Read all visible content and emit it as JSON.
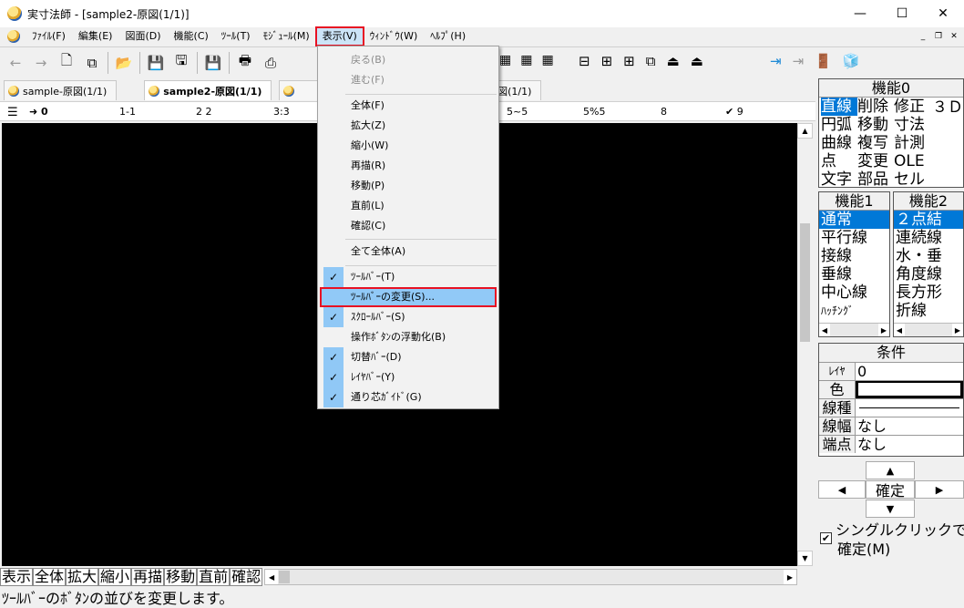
{
  "window": {
    "title": "実寸法師 - [sample2-原図(1/1)]"
  },
  "menubar": {
    "items": [
      "ﾌｧｲﾙ(F)",
      "編集(E)",
      "図面(D)",
      "機能(C)",
      "ﾂｰﾙ(T)",
      "ﾓｼﾞｭｰﾙ(M)",
      "表示(V)",
      "ｳｨﾝﾄﾞｳ(W)",
      "ﾍﾙﾌﾟ(H)"
    ]
  },
  "tabs": [
    "sample-原図(1/1)",
    "sample2-原図(1/1)",
    "e4-原図(1/1)"
  ],
  "layers": [
    "0",
    "1-1",
    "2 2",
    "3:3",
    "5~5",
    "5%5",
    "8",
    "9"
  ],
  "view_menu": {
    "items": [
      {
        "label": "戻る(B)"
      },
      {
        "label": "進む(F)"
      },
      {
        "label": "全体(F)"
      },
      {
        "label": "拡大(Z)"
      },
      {
        "label": "縮小(W)"
      },
      {
        "label": "再描(R)"
      },
      {
        "label": "移動(P)"
      },
      {
        "label": "直前(L)"
      },
      {
        "label": "確認(C)"
      },
      {
        "label": "全て全体(A)"
      },
      {
        "label": "ﾂｰﾙﾊﾞｰ(T)"
      },
      {
        "label": "ﾂｰﾙﾊﾞｰの変更(S)..."
      },
      {
        "label": "ｽｸﾛｰﾙﾊﾞｰ(S)"
      },
      {
        "label": "操作ﾎﾞﾀﾝの浮動化(B)"
      },
      {
        "label": "切替ﾊﾞｰ(D)"
      },
      {
        "label": "ﾚｲﾔﾊﾞｰ(Y)"
      },
      {
        "label": "通り芯ｶﾞｲﾄﾞ(G)"
      }
    ]
  },
  "command_bar": [
    "表示",
    "全体",
    "拡大",
    "縮小",
    "再描",
    "移動",
    "直前",
    "確認"
  ],
  "statusbar": {
    "text": "ﾂｰﾙﾊﾞｰのﾎﾞﾀﾝの並びを変更します。"
  },
  "panel_func0": {
    "title": "機能0",
    "cells": [
      "直線",
      "削除",
      "修正",
      "３Ｄ",
      "円弧",
      "移動",
      "寸法",
      "",
      "曲線",
      "複写",
      "計測",
      "",
      "点",
      "変更",
      "OLE",
      "",
      "文字",
      "部品",
      "セル",
      ""
    ]
  },
  "panel_func1": {
    "title": "機能1",
    "items": [
      "通常",
      "平行線",
      "接線",
      "垂線",
      "中心線",
      "ﾊｯﾁﾝｸﾞ"
    ]
  },
  "panel_func2": {
    "title": "機能2",
    "items": [
      "２点結",
      "連続線",
      "水・垂",
      "角度線",
      "長方形",
      "折線"
    ]
  },
  "conditions": {
    "title": "条件",
    "rows": [
      {
        "label": "ﾚｲﾔ",
        "value": "0"
      },
      {
        "label": "色",
        "value": ""
      },
      {
        "label": "線種",
        "value": ""
      },
      {
        "label": "線幅",
        "value": "なし"
      },
      {
        "label": "端点",
        "value": "なし"
      }
    ]
  },
  "nav": {
    "confirm": "確定"
  },
  "single_click": {
    "line1": "シングルクリックで",
    "line2": "確定(M)",
    "checked": true
  }
}
